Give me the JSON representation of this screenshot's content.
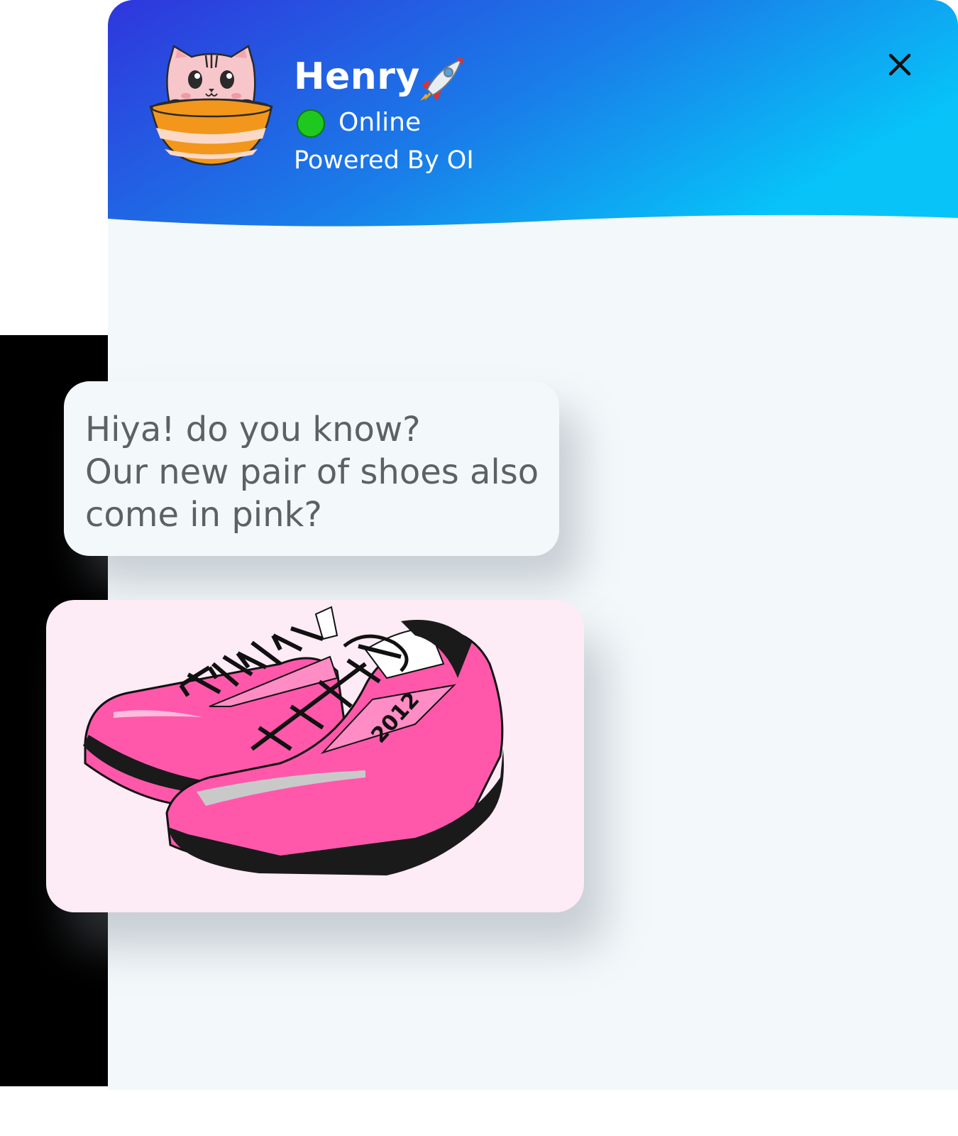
{
  "chat": {
    "agent_name": "Henry",
    "status": "Online",
    "powered_by": "Powered By OI",
    "close_icon": "close-icon",
    "rocket_icon": "rocket-emoji-icon",
    "header_gradient": [
      "#2f36dc",
      "#1a7be8",
      "#07c3f8"
    ]
  },
  "message": {
    "lines": [
      "Hiya! do you know?",
      "Our new pair of shoes also",
      "come in pink?"
    ]
  },
  "product_image": {
    "alt": "pink-sneakers",
    "shoe_text": "2012",
    "shoe_color": "#ff58ab"
  }
}
